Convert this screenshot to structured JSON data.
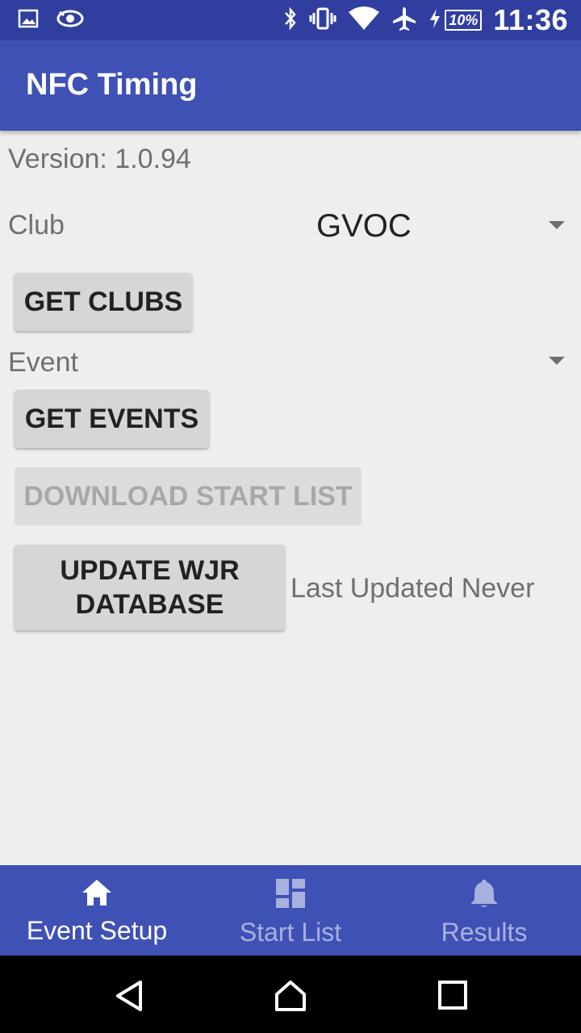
{
  "status_bar": {
    "time": "11:36",
    "battery": "10%",
    "icons": [
      "image-icon",
      "eye-icon",
      "bluetooth-icon",
      "vibrate-icon",
      "wifi-icon",
      "airplane-icon",
      "charging-icon"
    ]
  },
  "app_bar": {
    "title": "NFC Timing"
  },
  "main": {
    "version": "Version: 1.0.94",
    "club_label": "Club",
    "club_value": "GVOC",
    "get_clubs_label": "GET CLUBS",
    "event_label": "Event",
    "get_events_label": "GET EVENTS",
    "download_start_list_label": "DOWNLOAD START LIST",
    "update_db_line1": "UPDATE WJR",
    "update_db_line2": "DATABASE",
    "last_updated": "Last Updated Never"
  },
  "bottom_nav": {
    "items": [
      {
        "label": "Event Setup",
        "icon": "home-icon",
        "active": true
      },
      {
        "label": "Start List",
        "icon": "dashboard-icon",
        "active": false
      },
      {
        "label": "Results",
        "icon": "bell-icon",
        "active": false
      }
    ]
  },
  "colors": {
    "status_bar": "#303f9f",
    "primary": "#3f51b5",
    "background": "#eeeeee",
    "button": "#d6d6d6"
  }
}
